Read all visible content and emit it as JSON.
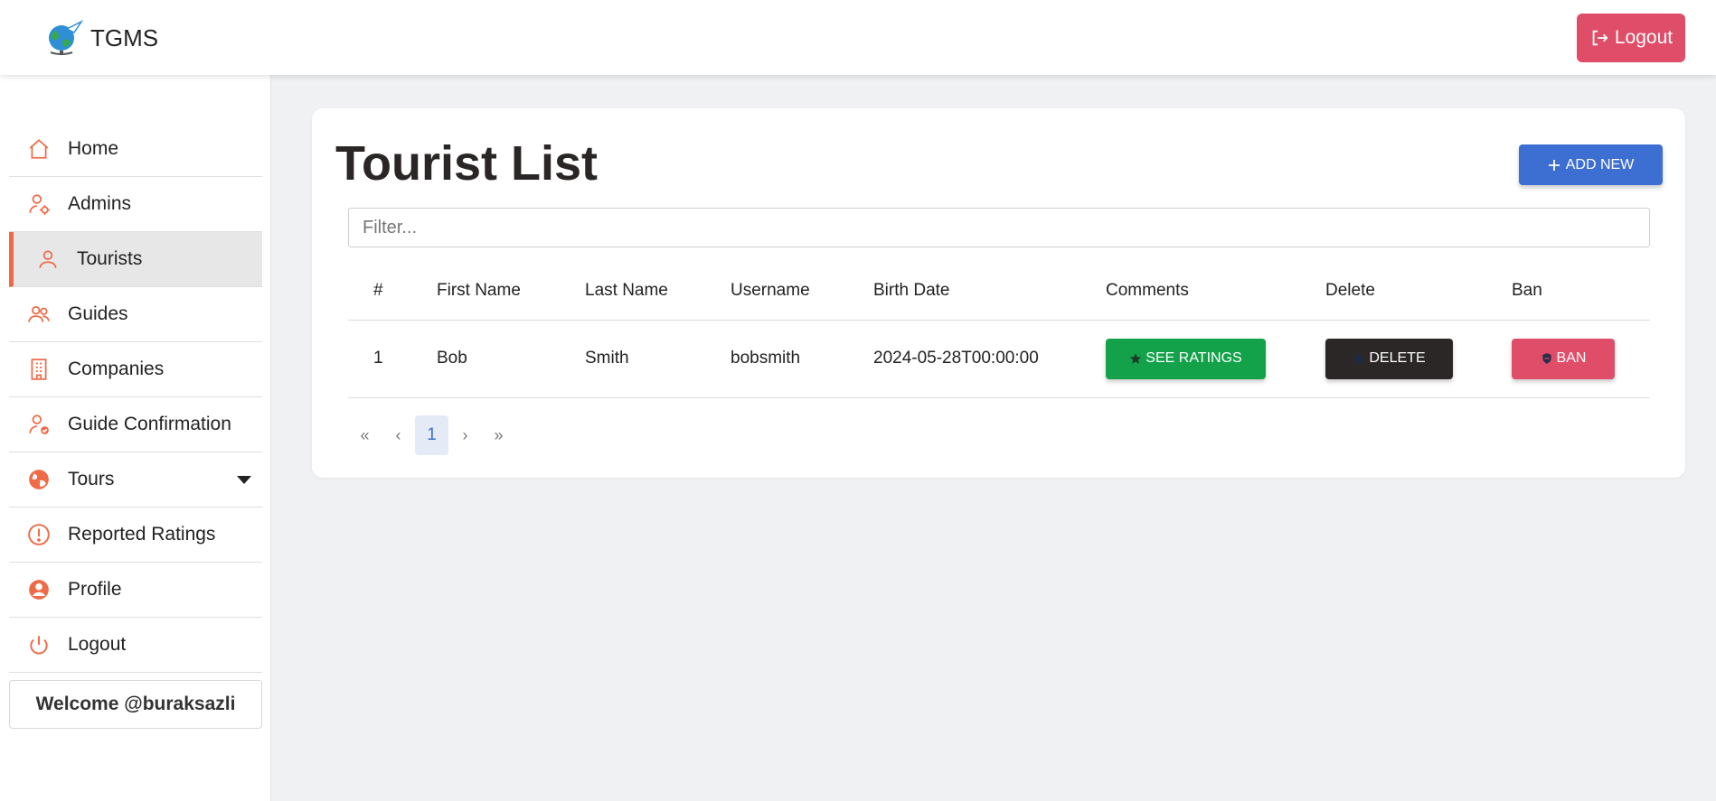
{
  "header": {
    "brand": "TGMS",
    "logout_label": "Logout"
  },
  "sidebar": {
    "items": [
      {
        "label": "Home",
        "icon": "home-icon"
      },
      {
        "label": "Admins",
        "icon": "user-gear-icon"
      },
      {
        "label": "Tourists",
        "icon": "user-icon",
        "active": true
      },
      {
        "label": "Guides",
        "icon": "users-icon"
      },
      {
        "label": "Companies",
        "icon": "building-icon"
      },
      {
        "label": "Guide Confirmation",
        "icon": "user-check-icon"
      },
      {
        "label": "Tours",
        "icon": "globe-icon"
      },
      {
        "label": "Reported Ratings",
        "icon": "alert-circle-icon"
      },
      {
        "label": "Profile",
        "icon": "profile-icon"
      },
      {
        "label": "Logout",
        "icon": "power-icon"
      }
    ],
    "welcome": "Welcome @buraksazli"
  },
  "main": {
    "title": "Tourist List",
    "add_new_label": "ADD NEW",
    "filter_placeholder": "Filter...",
    "columns": [
      "#",
      "First Name",
      "Last Name",
      "Username",
      "Birth Date",
      "Comments",
      "Delete",
      "Ban"
    ],
    "rows": [
      {
        "num": "1",
        "first_name": "Bob",
        "last_name": "Smith",
        "username": "bobsmith",
        "birth_date": "2024-05-28T00:00:00"
      }
    ],
    "actions": {
      "ratings_label": "SEE RATINGS",
      "delete_label": "DELETE",
      "ban_label": "BAN"
    },
    "pagination": {
      "first": "«",
      "prev": "‹",
      "current": "1",
      "next": "›",
      "last": "»"
    }
  },
  "colors": {
    "accent": "#ef6a47",
    "danger": "#e04d68",
    "primary": "#3c6fd1",
    "success": "#13a24a",
    "dark": "#2c2727"
  }
}
